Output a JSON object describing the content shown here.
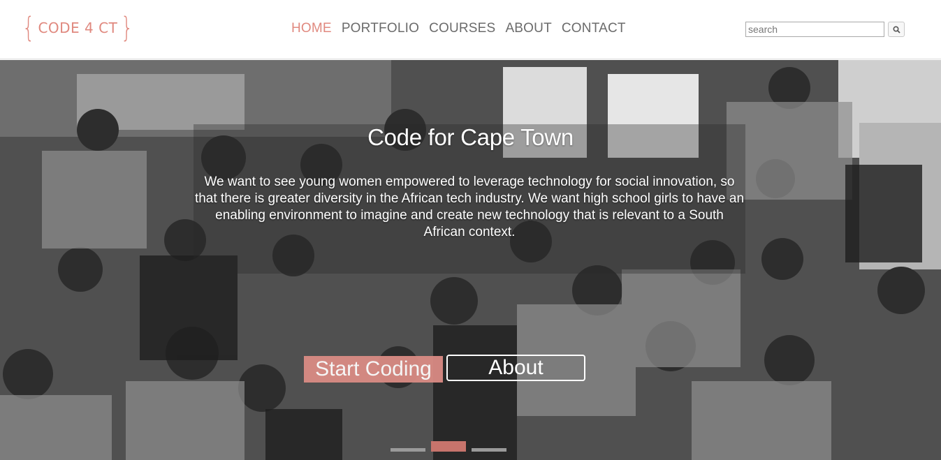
{
  "header": {
    "logo": {
      "brace_open": "{",
      "text": "CODE 4 CT",
      "brace_close": "}"
    },
    "nav": [
      {
        "label": "HOME",
        "active": true
      },
      {
        "label": "PORTFOLIO",
        "active": false
      },
      {
        "label": "COURSES",
        "active": false
      },
      {
        "label": "ABOUT",
        "active": false
      },
      {
        "label": "CONTACT",
        "active": false
      }
    ],
    "search": {
      "placeholder": "search",
      "value": "",
      "icon": "search-icon"
    }
  },
  "hero": {
    "title": "Code for Cape Town",
    "text": "We want to see young women empowered to leverage technology for social innovation, so that there is greater diversity in the African tech industry. We want high school girls to have an enabling environment to imagine and create new technology that is relevant to a South African context.",
    "buttons": {
      "start": "Start Coding",
      "about": "About"
    },
    "carousel": {
      "slides": 3,
      "active_index": 1
    }
  },
  "colors": {
    "accent": "#e0897f",
    "button": "#d98b84",
    "indicator_active": "#c7746c"
  }
}
